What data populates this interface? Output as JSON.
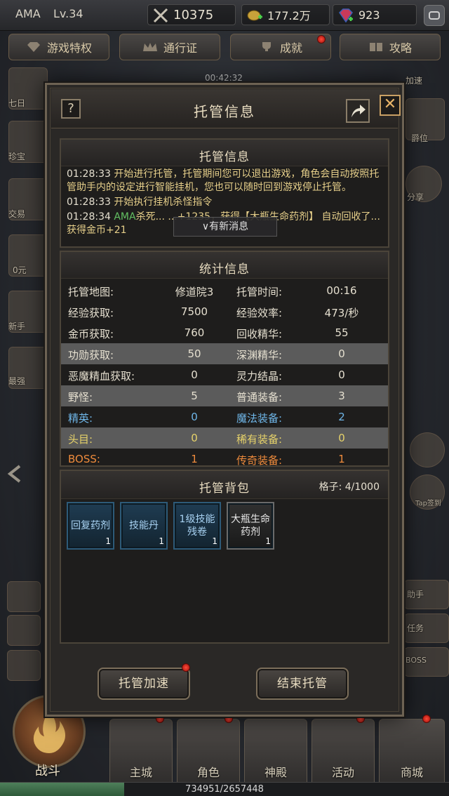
{
  "topbar": {
    "player_name": "AMA",
    "level": "Lv.34",
    "power": "10375",
    "gold": "177.2万",
    "gems": "923"
  },
  "nav": {
    "tabs": [
      {
        "label": "游戏特权"
      },
      {
        "label": "通行证"
      },
      {
        "label": "成就"
      },
      {
        "label": "攻略"
      }
    ]
  },
  "timer": "00:42:32",
  "dialog": {
    "title": "托管信息",
    "help_label": "?",
    "close_label": "✕",
    "log_panel": {
      "title": "托管信息",
      "lines": [
        {
          "time": "01:28:33",
          "text": "开始进行托管，托管期间您可以退出游戏，角色会自动按照托管助手内的设定进行智能挂机，您也可以随时回到游戏停止托管。"
        },
        {
          "time": "01:28:33",
          "text": "开始执行挂机杀怪指令"
        },
        {
          "time": "01:28:34",
          "name": "AMA",
          "text": "杀死...  ...+1235，获得【大瓶生命药剂】  自动回收了...  获得金币+21"
        }
      ],
      "new_msg_label": "∨有新消息"
    },
    "stats_panel": {
      "title": "统计信息",
      "rows": [
        {
          "l1": "托管地图:",
          "v1": "修道院3",
          "l2": "托管时间:",
          "v2": "00:16",
          "hl": false,
          "c1": "#e6e0d0",
          "c2": "#e6e0d0"
        },
        {
          "l1": "经验获取:",
          "v1": "7500",
          "l2": "经验效率:",
          "v2": "473/秒",
          "hl": false,
          "c1": "#e6e0d0",
          "c2": "#e6e0d0"
        },
        {
          "l1": "金币获取:",
          "v1": "760",
          "l2": "回收精华:",
          "v2": "55",
          "hl": false,
          "c1": "#e6e0d0",
          "c2": "#e6e0d0"
        },
        {
          "l1": "功勋获取:",
          "v1": "50",
          "l2": "深渊精华:",
          "v2": "0",
          "hl": true,
          "c1": "#e6e0d0",
          "c2": "#e6e0d0"
        },
        {
          "l1": "恶魔精血获取:",
          "v1": "0",
          "l2": "灵力结晶:",
          "v2": "0",
          "hl": false,
          "c1": "#e6e0d0",
          "c2": "#e6e0d0"
        },
        {
          "l1": "野怪:",
          "v1": "5",
          "l2": "普通装备:",
          "v2": "3",
          "hl": true,
          "c1": "#e6e0d0",
          "c2": "#e6e0d0"
        },
        {
          "l1": "精英:",
          "v1": "0",
          "l2": "魔法装备:",
          "v2": "2",
          "hl": false,
          "c1": "#6fb6e8",
          "c2": "#6fb6e8"
        },
        {
          "l1": "头目:",
          "v1": "0",
          "l2": "稀有装备:",
          "v2": "0",
          "hl": true,
          "c1": "#e6d26a",
          "c2": "#e6d26a"
        },
        {
          "l1": "BOSS:",
          "v1": "1",
          "l2": "传奇装备:",
          "v2": "1",
          "hl": false,
          "c1": "#ef8b3c",
          "c2": "#ef8b3c"
        }
      ]
    },
    "bag_panel": {
      "title": "托管背包",
      "grid_label": "格子: 4/1000",
      "items": [
        {
          "name": "回复药剂",
          "count": "1"
        },
        {
          "name": "技能丹",
          "count": "1"
        },
        {
          "name": "1级技能残卷",
          "count": "1"
        },
        {
          "name": "大瓶生命药剂",
          "count": "1"
        }
      ]
    },
    "accelerate_label": "托管加速",
    "end_label": "结束托管"
  },
  "side_labels": {
    "left": [
      "七日",
      "珍宝",
      "交易",
      "0元",
      "新手",
      "最强"
    ],
    "right": [
      "加速",
      "爵位",
      "分享",
      "Tap签到",
      "助手",
      "任务",
      "BOSS"
    ]
  },
  "bottom": {
    "fight_label": "战斗",
    "buttons": [
      {
        "label": "主城"
      },
      {
        "label": "角色"
      },
      {
        "label": "神殿"
      },
      {
        "label": "活动"
      },
      {
        "label": "商城"
      }
    ],
    "exp_text": "734951/2657448",
    "exp_progress": 0.2765
  },
  "colors": {
    "accent_gold": "#e6cf8a",
    "magic_blue": "#6fb6e8",
    "rare_yellow": "#e6d26a",
    "legend_orange": "#ef8b3c",
    "frame": "#6d6253"
  }
}
